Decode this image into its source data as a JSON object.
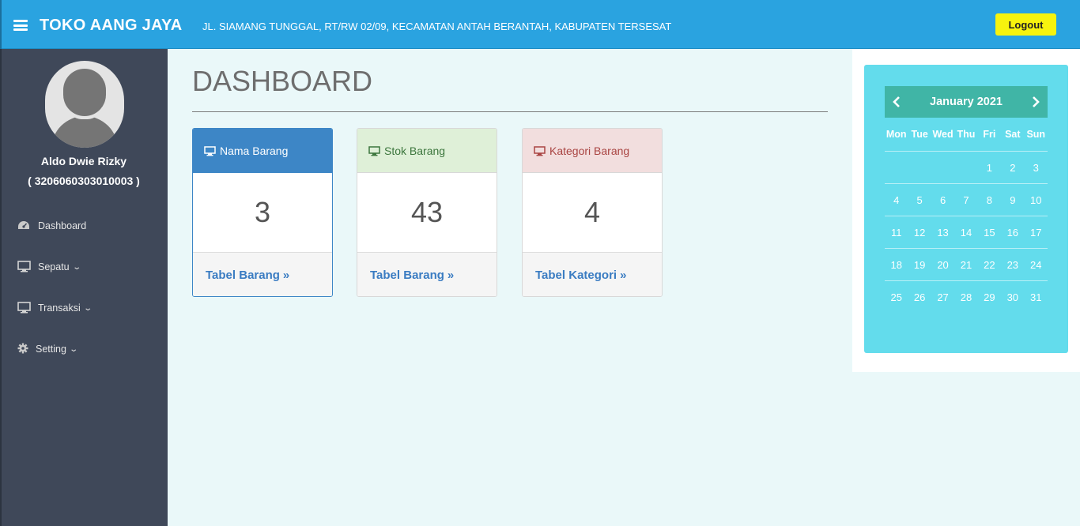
{
  "header": {
    "brand": "TOKO AANG JAYA",
    "address": "JL. SIAMANG TUNGGAL, RT/RW 02/09, KECAMATAN ANTAH BERANTAH, KABUPATEN TERSESAT",
    "logout_label": "Logout"
  },
  "sidebar": {
    "user_name": "Aldo Dwie Rizky",
    "user_id": "( 3206060303010003 )",
    "items": [
      {
        "label": "Dashboard",
        "icon": "dashboard-icon"
      },
      {
        "label": "Sepatu",
        "icon": "monitor-icon"
      },
      {
        "label": "Transaksi",
        "icon": "monitor-icon"
      },
      {
        "label": "Setting",
        "icon": "gear-icon"
      }
    ]
  },
  "main": {
    "title": "DASHBOARD",
    "cards": [
      {
        "title": "Nama Barang",
        "value": "3",
        "link": "Tabel Barang",
        "color": "#3d86c6"
      },
      {
        "title": "Stok Barang",
        "value": "43",
        "link": "Tabel Barang",
        "color": "#dff0d8"
      },
      {
        "title": "Kategori Barang",
        "value": "4",
        "link": "Tabel Kategori",
        "color": "#f2dede"
      }
    ]
  },
  "calendar": {
    "month_label": "January 2021",
    "days_of_week": [
      "Mon",
      "Tue",
      "Wed",
      "Thu",
      "Fri",
      "Sat",
      "Sun"
    ],
    "weeks": [
      [
        "",
        "",
        "",
        "",
        "1",
        "2",
        "3"
      ],
      [
        "4",
        "5",
        "6",
        "7",
        "8",
        "9",
        "10"
      ],
      [
        "11",
        "12",
        "13",
        "14",
        "15",
        "16",
        "17"
      ],
      [
        "18",
        "19",
        "20",
        "21",
        "22",
        "23",
        "24"
      ],
      [
        "25",
        "26",
        "27",
        "28",
        "29",
        "30",
        "31"
      ]
    ],
    "bg_color": "#63dcec",
    "header_color": "#40b5a6"
  }
}
